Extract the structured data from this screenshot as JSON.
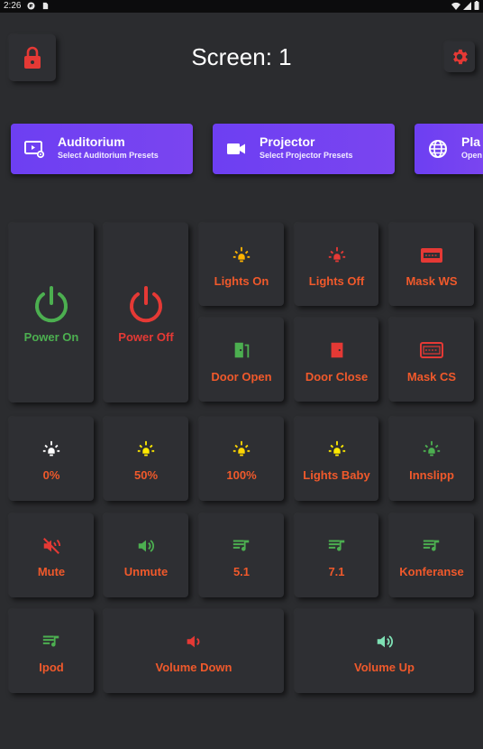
{
  "status_bar": {
    "time": "2:26"
  },
  "header": {
    "title": "Screen: 1"
  },
  "colors": {
    "accent": "#6d3ff2",
    "label": "#f0592b",
    "danger": "#e53935",
    "green": "#4caf50",
    "yellow": "#ffd600",
    "orange": "#ffb300",
    "teal": "#7ee0b4"
  },
  "presets": [
    {
      "name": "Auditorium",
      "subtitle": "Select Auditorium Presets",
      "icon": "video-settings-icon"
    },
    {
      "name": "Projector",
      "subtitle": "Select Projector Presets",
      "icon": "videocam-icon"
    },
    {
      "name": "Pla",
      "subtitle": "Open",
      "icon": "globe-icon"
    }
  ],
  "controls": {
    "power_on": "Power On",
    "power_off": "Power Off",
    "lights_on": "Lights On",
    "lights_off": "Lights Off",
    "mask_ws": "Mask WS",
    "door_open": "Door Open",
    "door_close": "Door Close",
    "mask_cs": "Mask CS",
    "light_0": "0%",
    "light_50": "50%",
    "light_100": "100%",
    "lights_baby": "Lights Baby",
    "innslipp": "Innslipp",
    "mute": "Mute",
    "unmute": "Unmute",
    "audio_51": "5.1",
    "audio_71": "7.1",
    "konferanse": "Konferanse",
    "ipod": "Ipod",
    "volume_down": "Volume Down",
    "volume_up": "Volume Up"
  }
}
